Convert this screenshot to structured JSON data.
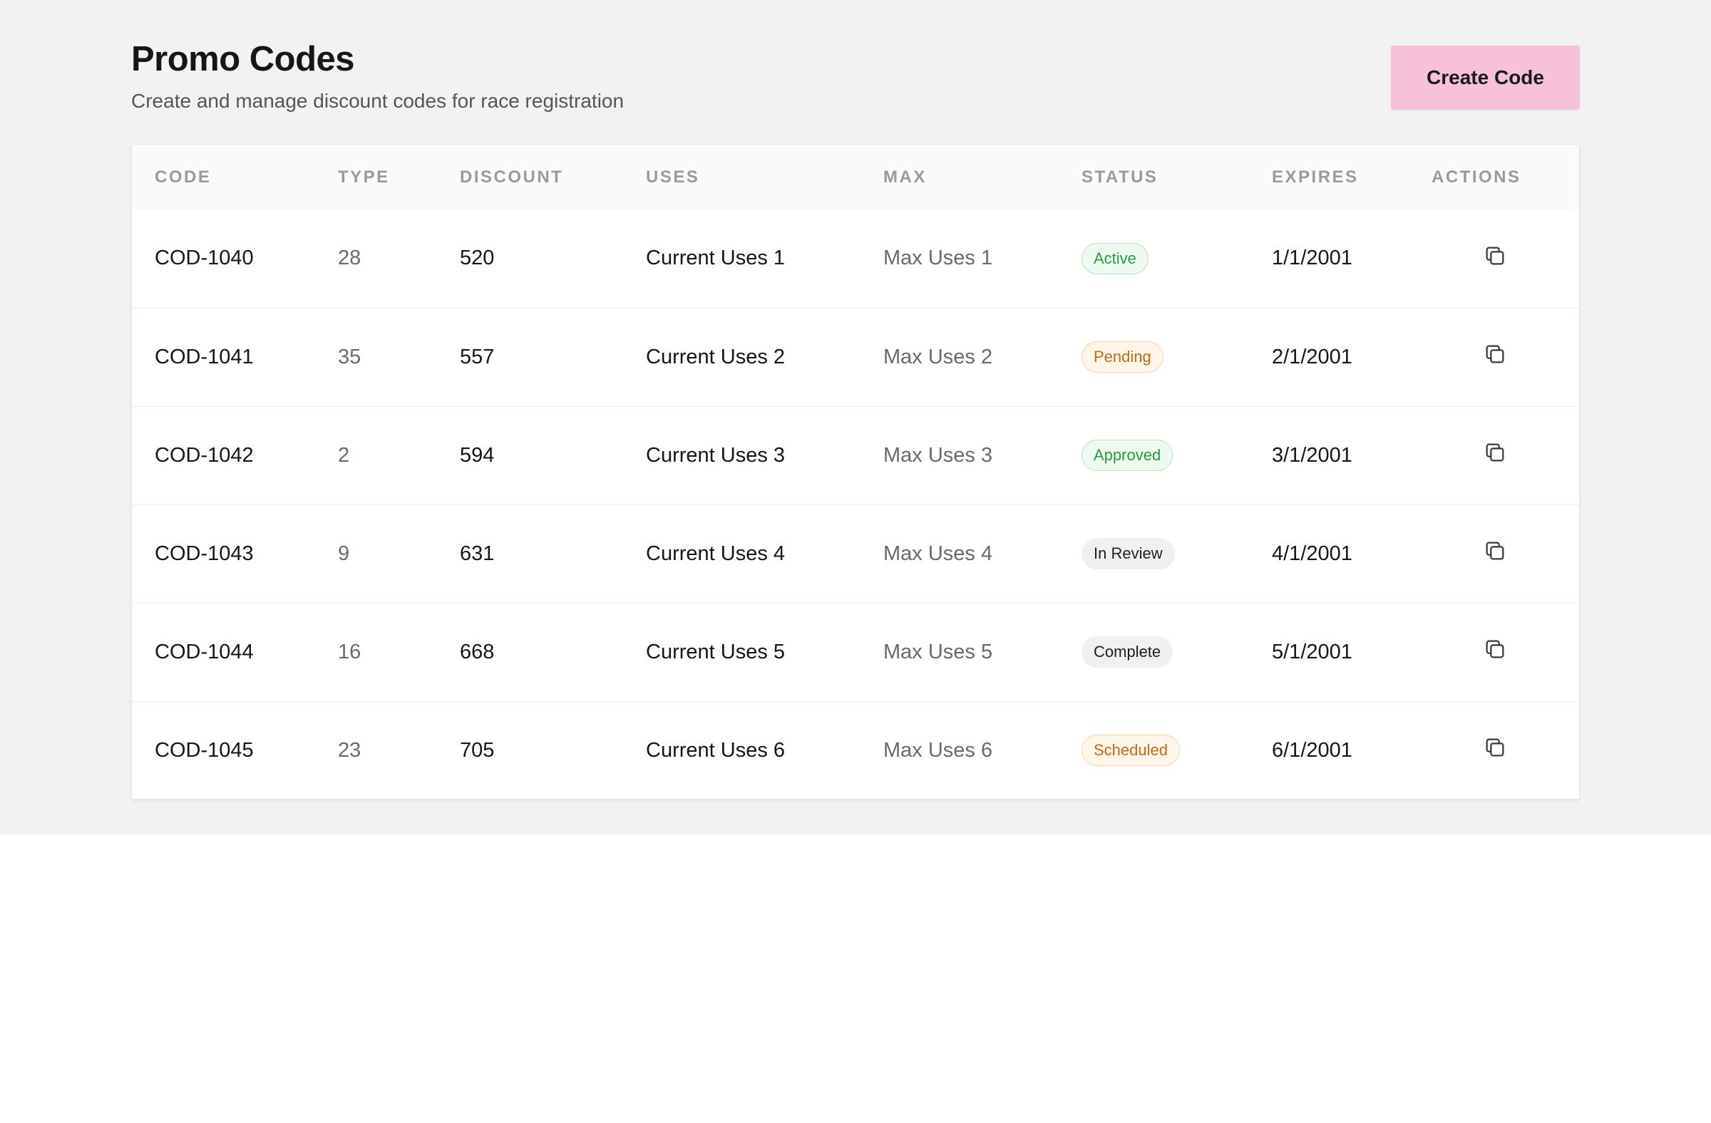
{
  "header": {
    "title": "Promo Codes",
    "subtitle": "Create and manage discount codes for race registration",
    "create_label": "Create Code"
  },
  "colors": {
    "button_bg": "#f7c2d8",
    "page_bg": "#f2f2f2",
    "badge_green": "#2a9a46",
    "badge_orange": "#c2691c"
  },
  "table": {
    "columns": [
      "CODE",
      "TYPE",
      "DISCOUNT",
      "USES",
      "MAX",
      "STATUS",
      "EXPIRES",
      "ACTIONS"
    ],
    "rows": [
      {
        "code": "COD-1040",
        "type": "28",
        "discount": "520",
        "uses": "Current Uses 1",
        "max": "Max Uses 1",
        "status": "Active",
        "status_tone": "green",
        "expires": "1/1/2001",
        "action_icon": "copy-icon"
      },
      {
        "code": "COD-1041",
        "type": "35",
        "discount": "557",
        "uses": "Current Uses 2",
        "max": "Max Uses 2",
        "status": "Pending",
        "status_tone": "orange",
        "expires": "2/1/2001",
        "action_icon": "copy-icon"
      },
      {
        "code": "COD-1042",
        "type": "2",
        "discount": "594",
        "uses": "Current Uses 3",
        "max": "Max Uses 3",
        "status": "Approved",
        "status_tone": "green",
        "expires": "3/1/2001",
        "action_icon": "copy-icon"
      },
      {
        "code": "COD-1043",
        "type": "9",
        "discount": "631",
        "uses": "Current Uses 4",
        "max": "Max Uses 4",
        "status": "In Review",
        "status_tone": "gray",
        "expires": "4/1/2001",
        "action_icon": "copy-icon"
      },
      {
        "code": "COD-1044",
        "type": "16",
        "discount": "668",
        "uses": "Current Uses 5",
        "max": "Max Uses 5",
        "status": "Complete",
        "status_tone": "gray",
        "expires": "5/1/2001",
        "action_icon": "copy-icon"
      },
      {
        "code": "COD-1045",
        "type": "23",
        "discount": "705",
        "uses": "Current Uses 6",
        "max": "Max Uses 6",
        "status": "Scheduled",
        "status_tone": "orange",
        "expires": "6/1/2001",
        "action_icon": "copy-icon"
      }
    ]
  }
}
